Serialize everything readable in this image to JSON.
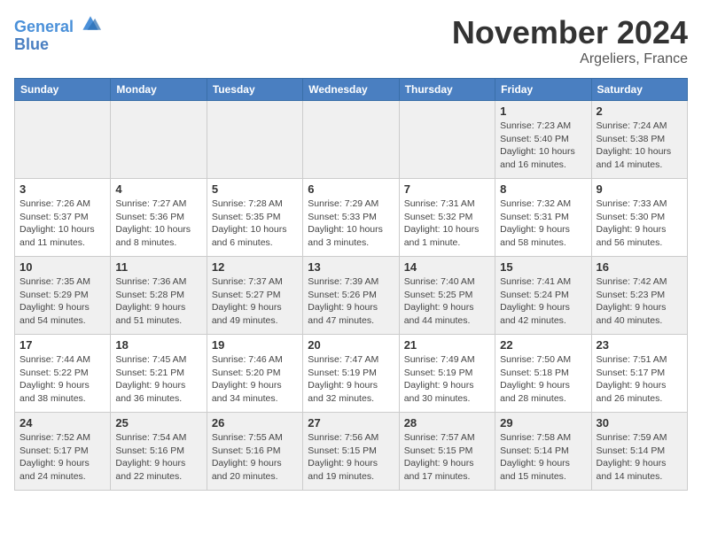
{
  "header": {
    "logo_line1": "General",
    "logo_line2": "Blue",
    "month": "November 2024",
    "location": "Argeliers, France"
  },
  "days_of_week": [
    "Sunday",
    "Monday",
    "Tuesday",
    "Wednesday",
    "Thursday",
    "Friday",
    "Saturday"
  ],
  "weeks": [
    [
      {
        "day": "",
        "info": ""
      },
      {
        "day": "",
        "info": ""
      },
      {
        "day": "",
        "info": ""
      },
      {
        "day": "",
        "info": ""
      },
      {
        "day": "",
        "info": ""
      },
      {
        "day": "1",
        "info": "Sunrise: 7:23 AM\nSunset: 5:40 PM\nDaylight: 10 hours and 16 minutes."
      },
      {
        "day": "2",
        "info": "Sunrise: 7:24 AM\nSunset: 5:38 PM\nDaylight: 10 hours and 14 minutes."
      }
    ],
    [
      {
        "day": "3",
        "info": "Sunrise: 7:26 AM\nSunset: 5:37 PM\nDaylight: 10 hours and 11 minutes."
      },
      {
        "day": "4",
        "info": "Sunrise: 7:27 AM\nSunset: 5:36 PM\nDaylight: 10 hours and 8 minutes."
      },
      {
        "day": "5",
        "info": "Sunrise: 7:28 AM\nSunset: 5:35 PM\nDaylight: 10 hours and 6 minutes."
      },
      {
        "day": "6",
        "info": "Sunrise: 7:29 AM\nSunset: 5:33 PM\nDaylight: 10 hours and 3 minutes."
      },
      {
        "day": "7",
        "info": "Sunrise: 7:31 AM\nSunset: 5:32 PM\nDaylight: 10 hours and 1 minute."
      },
      {
        "day": "8",
        "info": "Sunrise: 7:32 AM\nSunset: 5:31 PM\nDaylight: 9 hours and 58 minutes."
      },
      {
        "day": "9",
        "info": "Sunrise: 7:33 AM\nSunset: 5:30 PM\nDaylight: 9 hours and 56 minutes."
      }
    ],
    [
      {
        "day": "10",
        "info": "Sunrise: 7:35 AM\nSunset: 5:29 PM\nDaylight: 9 hours and 54 minutes."
      },
      {
        "day": "11",
        "info": "Sunrise: 7:36 AM\nSunset: 5:28 PM\nDaylight: 9 hours and 51 minutes."
      },
      {
        "day": "12",
        "info": "Sunrise: 7:37 AM\nSunset: 5:27 PM\nDaylight: 9 hours and 49 minutes."
      },
      {
        "day": "13",
        "info": "Sunrise: 7:39 AM\nSunset: 5:26 PM\nDaylight: 9 hours and 47 minutes."
      },
      {
        "day": "14",
        "info": "Sunrise: 7:40 AM\nSunset: 5:25 PM\nDaylight: 9 hours and 44 minutes."
      },
      {
        "day": "15",
        "info": "Sunrise: 7:41 AM\nSunset: 5:24 PM\nDaylight: 9 hours and 42 minutes."
      },
      {
        "day": "16",
        "info": "Sunrise: 7:42 AM\nSunset: 5:23 PM\nDaylight: 9 hours and 40 minutes."
      }
    ],
    [
      {
        "day": "17",
        "info": "Sunrise: 7:44 AM\nSunset: 5:22 PM\nDaylight: 9 hours and 38 minutes."
      },
      {
        "day": "18",
        "info": "Sunrise: 7:45 AM\nSunset: 5:21 PM\nDaylight: 9 hours and 36 minutes."
      },
      {
        "day": "19",
        "info": "Sunrise: 7:46 AM\nSunset: 5:20 PM\nDaylight: 9 hours and 34 minutes."
      },
      {
        "day": "20",
        "info": "Sunrise: 7:47 AM\nSunset: 5:19 PM\nDaylight: 9 hours and 32 minutes."
      },
      {
        "day": "21",
        "info": "Sunrise: 7:49 AM\nSunset: 5:19 PM\nDaylight: 9 hours and 30 minutes."
      },
      {
        "day": "22",
        "info": "Sunrise: 7:50 AM\nSunset: 5:18 PM\nDaylight: 9 hours and 28 minutes."
      },
      {
        "day": "23",
        "info": "Sunrise: 7:51 AM\nSunset: 5:17 PM\nDaylight: 9 hours and 26 minutes."
      }
    ],
    [
      {
        "day": "24",
        "info": "Sunrise: 7:52 AM\nSunset: 5:17 PM\nDaylight: 9 hours and 24 minutes."
      },
      {
        "day": "25",
        "info": "Sunrise: 7:54 AM\nSunset: 5:16 PM\nDaylight: 9 hours and 22 minutes."
      },
      {
        "day": "26",
        "info": "Sunrise: 7:55 AM\nSunset: 5:16 PM\nDaylight: 9 hours and 20 minutes."
      },
      {
        "day": "27",
        "info": "Sunrise: 7:56 AM\nSunset: 5:15 PM\nDaylight: 9 hours and 19 minutes."
      },
      {
        "day": "28",
        "info": "Sunrise: 7:57 AM\nSunset: 5:15 PM\nDaylight: 9 hours and 17 minutes."
      },
      {
        "day": "29",
        "info": "Sunrise: 7:58 AM\nSunset: 5:14 PM\nDaylight: 9 hours and 15 minutes."
      },
      {
        "day": "30",
        "info": "Sunrise: 7:59 AM\nSunset: 5:14 PM\nDaylight: 9 hours and 14 minutes."
      }
    ]
  ]
}
